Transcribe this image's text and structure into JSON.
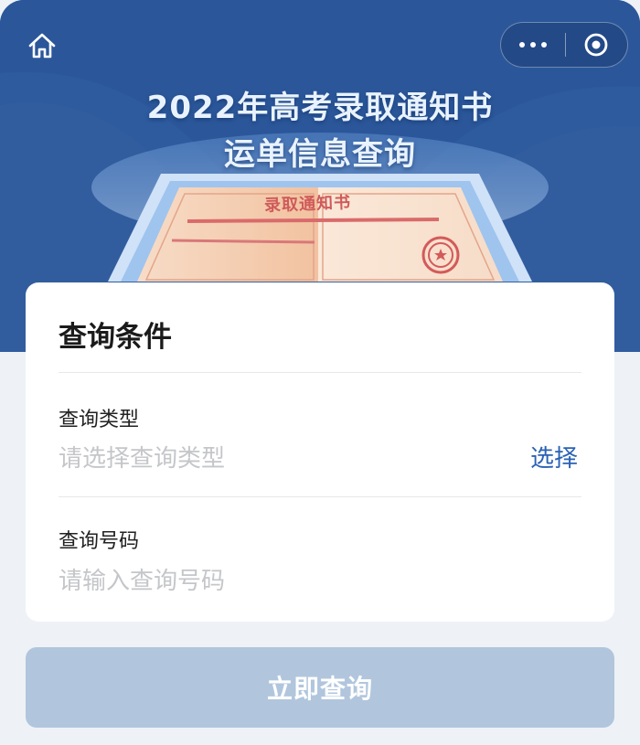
{
  "header": {
    "title_line1": "2022年高考录取通知书",
    "title_line2": "运单信息查询",
    "illustration_text": "录取通知书",
    "home_icon": "home-icon",
    "more_icon": "more-dots-icon",
    "close_icon": "target-close-icon"
  },
  "form": {
    "heading": "查询条件",
    "query_type": {
      "label": "查询类型",
      "placeholder": "请选择查询类型",
      "action": "选择"
    },
    "query_number": {
      "label": "查询号码",
      "placeholder": "请输入查询号码"
    }
  },
  "submit_label": "立即查询",
  "colors": {
    "brand_blue": "#2d5b9e",
    "link_blue": "#2a62b5",
    "disabled_button": "#b1c6dd",
    "page_bg": "#eef2f6"
  }
}
